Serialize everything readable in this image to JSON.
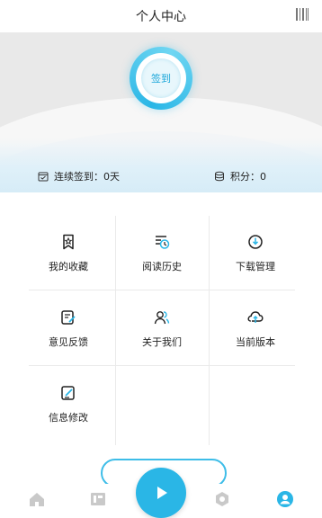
{
  "header": {
    "title": "个人中心",
    "qr_icon": "qr-code-icon"
  },
  "signin": {
    "label": "签到"
  },
  "stats": {
    "streak": "连续签到：0天",
    "points": "积分：0"
  },
  "menu": [
    {
      "label": "我的收藏",
      "icon": "favorite-icon"
    },
    {
      "label": "阅读历史",
      "icon": "history-icon"
    },
    {
      "label": "下载管理",
      "icon": "download-icon"
    },
    {
      "label": "意见反馈",
      "icon": "feedback-icon"
    },
    {
      "label": "关于我们",
      "icon": "about-icon"
    },
    {
      "label": "当前版本",
      "icon": "cloud-version-icon"
    },
    {
      "label": "信息修改",
      "icon": "edit-info-icon"
    }
  ],
  "bottom_nav": [
    {
      "icon": "home-icon"
    },
    {
      "icon": "library-icon"
    },
    {
      "icon": "play-icon"
    },
    {
      "icon": "hexagon-icon"
    },
    {
      "icon": "profile-icon"
    }
  ],
  "colors": {
    "accent": "#2ab6e6",
    "text": "#222222",
    "banner_bg": "#e9e9e9"
  }
}
